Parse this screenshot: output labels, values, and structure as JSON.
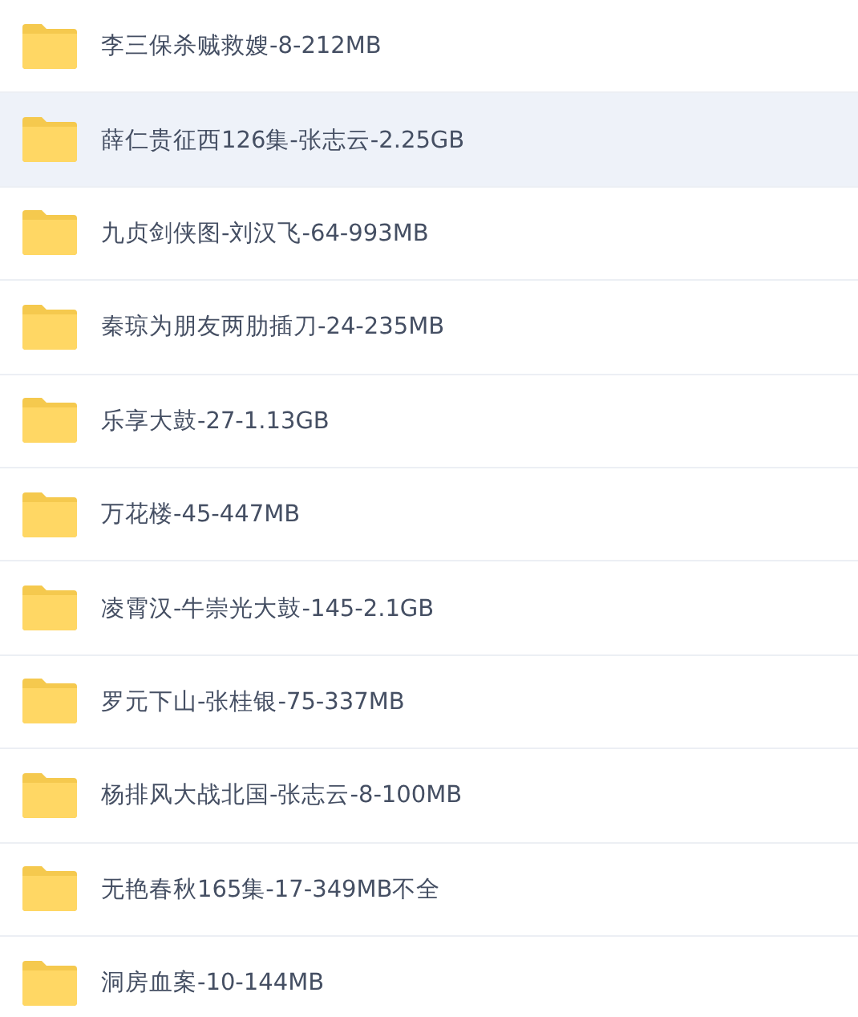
{
  "files": [
    {
      "name": "李三保杀贼救嫂-8-212MB",
      "selected": false
    },
    {
      "name": "薛仁贵征西126集-张志云-2.25GB",
      "selected": true
    },
    {
      "name": "九贞剑侠图-刘汉飞-64-993MB",
      "selected": false
    },
    {
      "name": "秦琼为朋友两肋插刀-24-235MB",
      "selected": false
    },
    {
      "name": "乐享大鼓-27-1.13GB",
      "selected": false
    },
    {
      "name": "万花楼-45-447MB",
      "selected": false
    },
    {
      "name": "凌霄汉-牛崇光大鼓-145-2.1GB",
      "selected": false
    },
    {
      "name": "罗元下山-张桂银-75-337MB",
      "selected": false
    },
    {
      "name": "杨排风大战北国-张志云-8-100MB",
      "selected": false
    },
    {
      "name": "无艳春秋165集-17-349MB不全",
      "selected": false
    },
    {
      "name": "洞房血案-10-144MB",
      "selected": false
    }
  ]
}
